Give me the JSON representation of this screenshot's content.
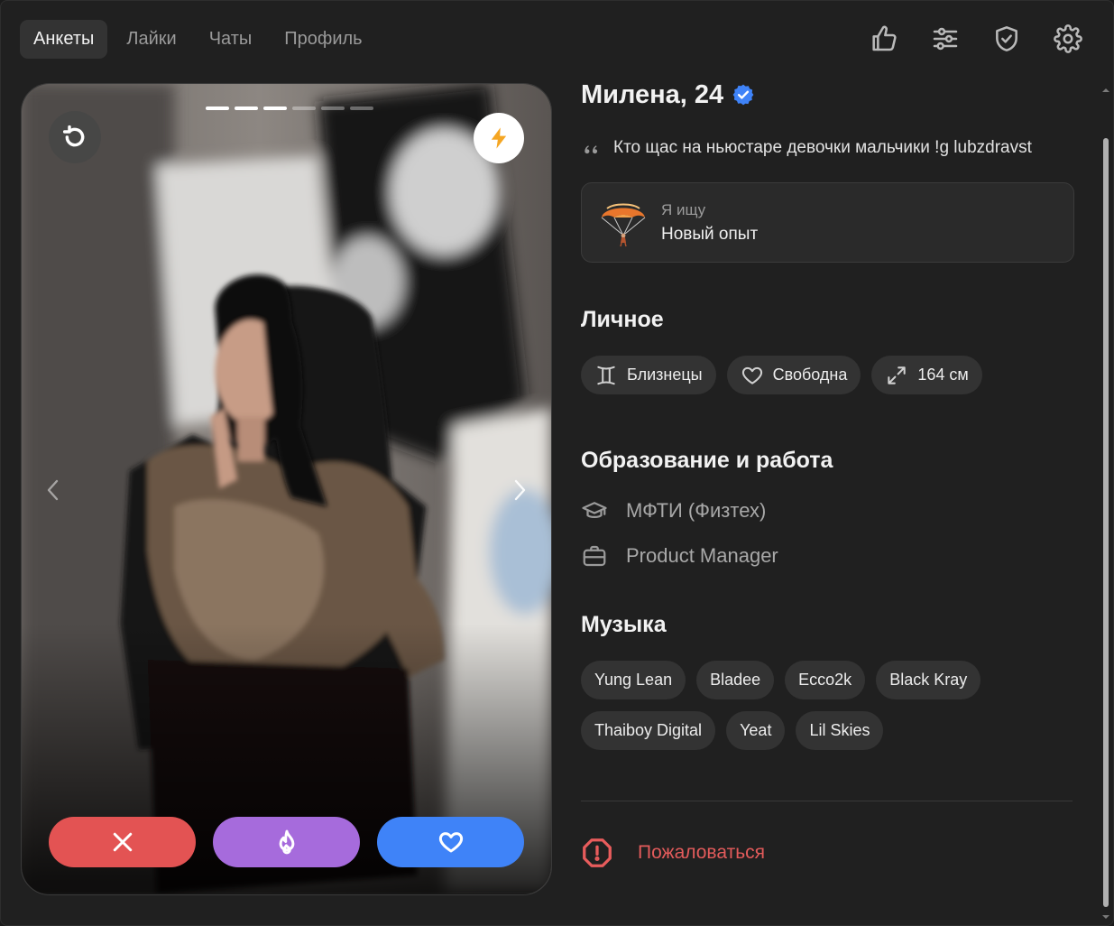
{
  "nav": {
    "tabs": [
      {
        "label": "Анкеты",
        "active": true
      },
      {
        "label": "Лайки",
        "active": false
      },
      {
        "label": "Чаты",
        "active": false
      },
      {
        "label": "Профиль",
        "active": false
      }
    ],
    "icons": [
      "thumbs-up-icon",
      "sliders-icon",
      "shield-check-icon",
      "gear-icon"
    ]
  },
  "photo": {
    "photo_count": 6,
    "current_photo": 3,
    "buttons": {
      "undo": "undo-icon",
      "boost": "lightning-icon",
      "dislike": "close-icon",
      "superlike": "flame-icon",
      "like": "heart-icon"
    },
    "colors": {
      "dislike": "#e35353",
      "superlike": "#a66bdc",
      "like": "#3f83f8",
      "boost": "#f5a623"
    }
  },
  "profile": {
    "name_age": "Милена, 24",
    "verified": true,
    "bio": "Кто щас на ньюстаре девочки мальчики !g lubzdravst",
    "seeking": {
      "label": "Я ищу",
      "value": "Новый опыт",
      "icon": "parachute-icon"
    },
    "personal": {
      "title": "Личное",
      "chips": [
        {
          "icon": "gemini-icon",
          "label": "Близнецы"
        },
        {
          "icon": "heart-outline-icon",
          "label": "Свободна"
        },
        {
          "icon": "expand-arrows-icon",
          "label": "164 см"
        }
      ]
    },
    "education": {
      "title": "Образование и работа",
      "school": "МФТИ (Физтех)",
      "job": "Product Manager"
    },
    "music": {
      "title": "Музыка",
      "artists": [
        "Yung Lean",
        "Bladee",
        "Ecco2k",
        "Black Kray",
        "Thaiboy Digital",
        "Yeat",
        "Lil Skies"
      ]
    },
    "report_label": "Пожаловаться"
  },
  "theme": {
    "accent_blue": "#3f83f8",
    "danger": "#e35b5b",
    "bg": "#202020"
  }
}
